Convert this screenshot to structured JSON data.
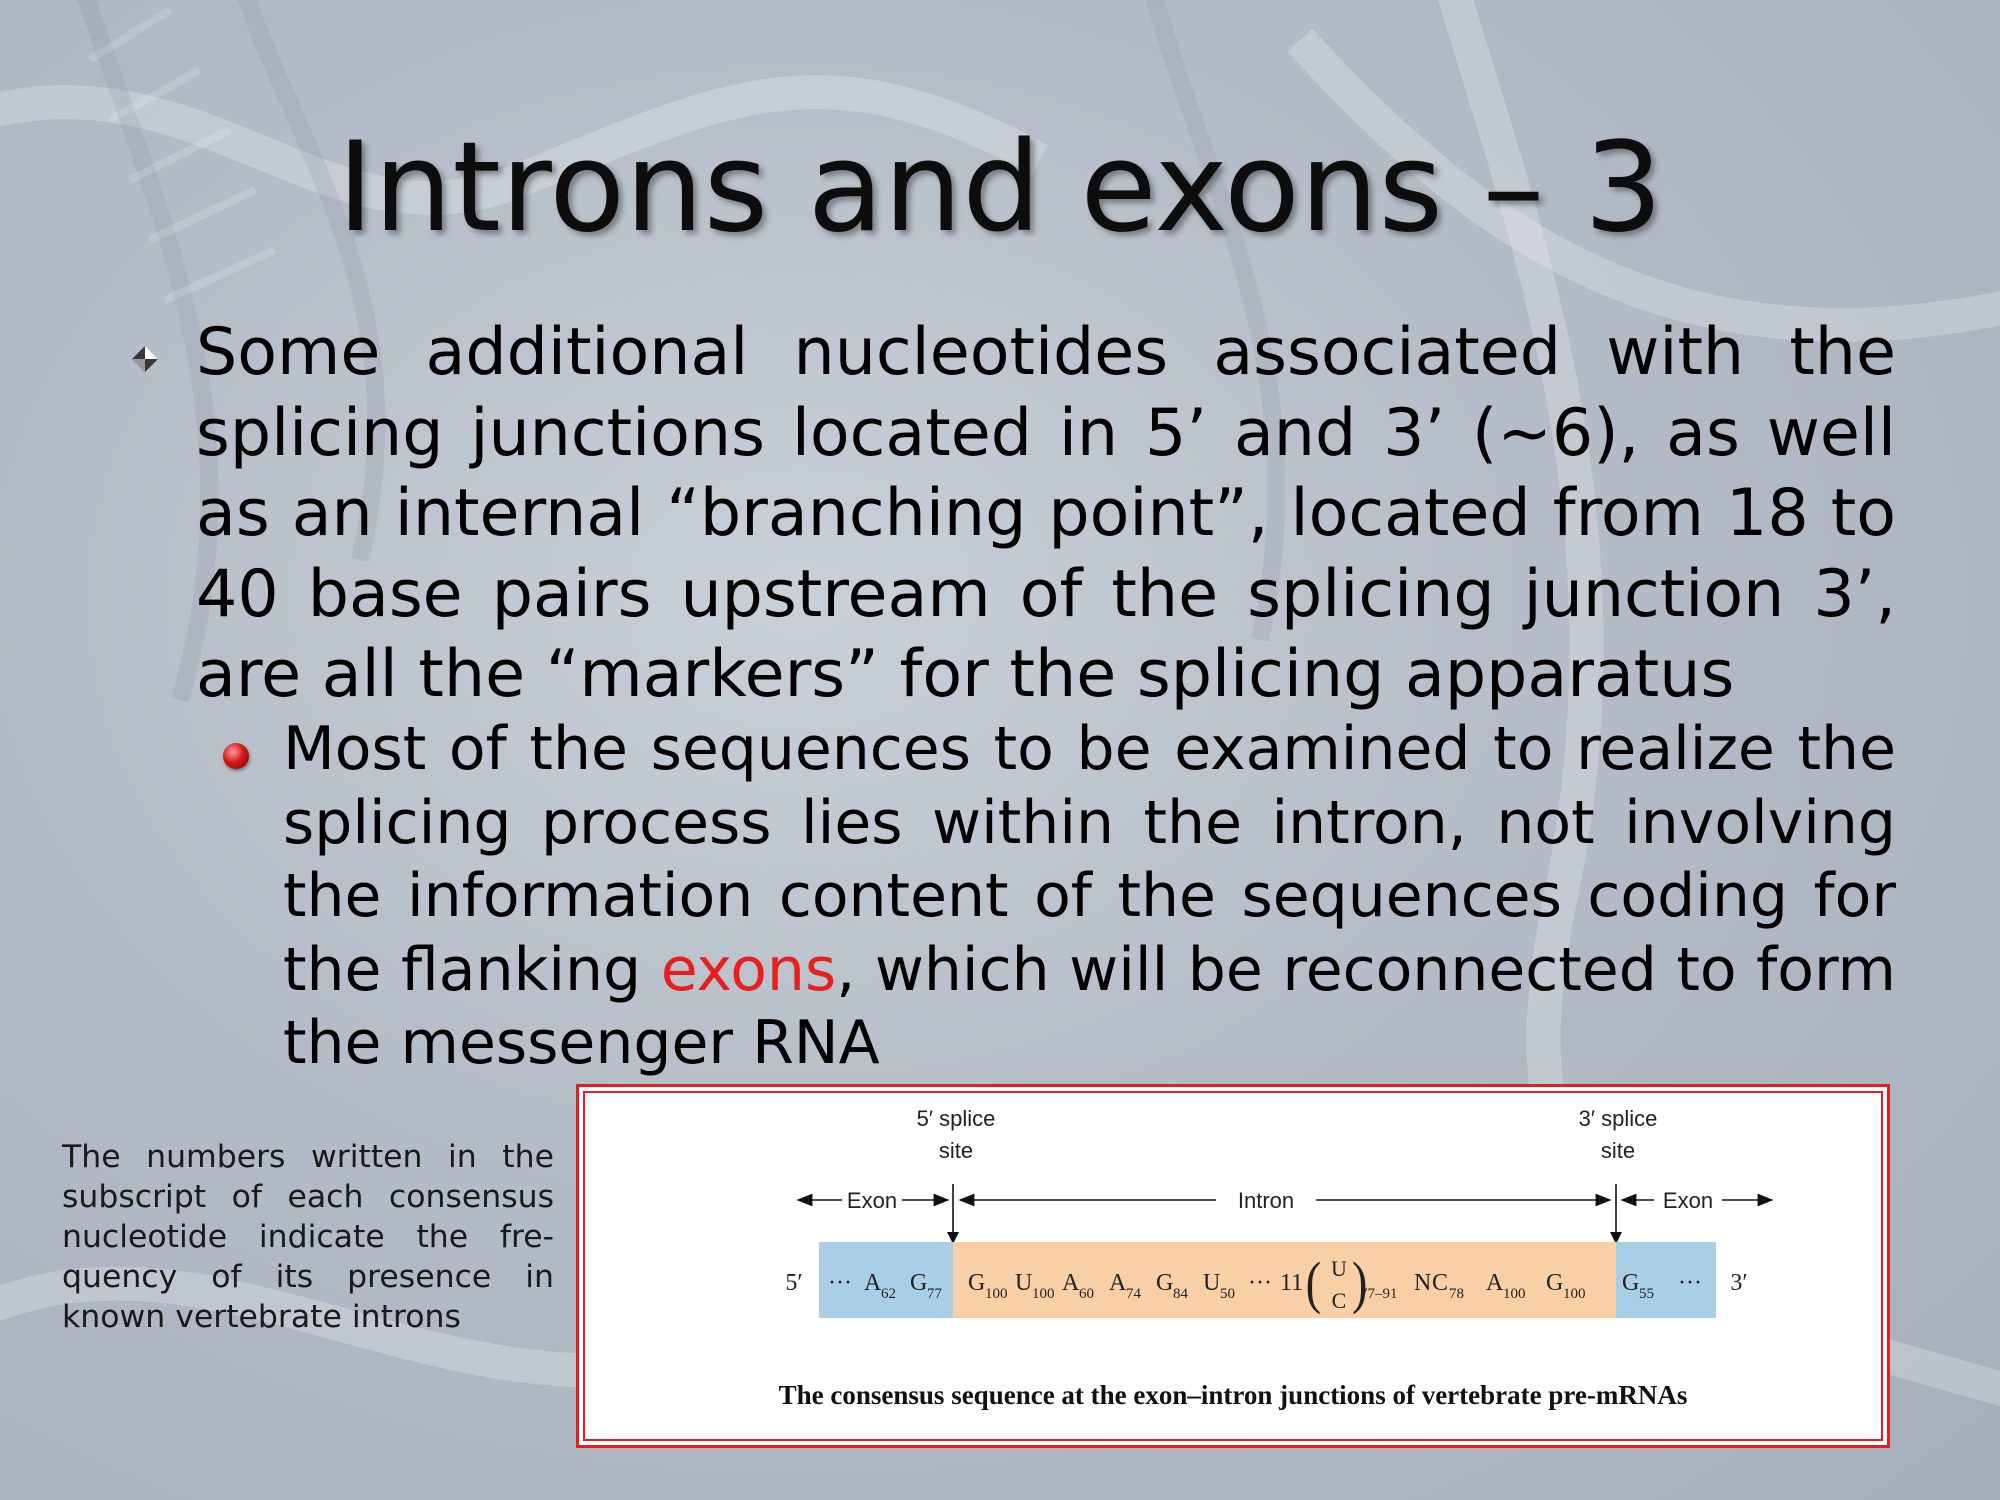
{
  "slide": {
    "title": "Introns and exons – 3",
    "bullet1": "Some additional nucleotides associated with the splicing junctions located in 5’ and 3’ (~6), as well as an internal “branching point”, located from 18 to 40 base pairs upstream of the splicing junction 3’, are all the “markers” for the splicing apparatus",
    "bullet2": {
      "before": "Most of the sequences to be examined to realize the splicing process lies within the intron, not involving the information content of the sequences coding for the flanking ",
      "highlight": "exons",
      "after": ", which will be reconnected to form the messenger RNA"
    },
    "caption": "The numbers written in the subscript of each consensus nucleotide indicate the fre-quency of its presence in known vertebrate introns"
  },
  "figure": {
    "label_5_splice": "5′ splice",
    "label_3_splice": "3′ splice",
    "label_site": "site",
    "label_exon": "Exon",
    "label_intron": "Intron",
    "end_5": "5′",
    "end_3": "3′",
    "dots": "···",
    "n11": "11",
    "sub_77_91": "77–91",
    "caption": "The consensus sequence at the exon–intron junctions of vertebrate pre-mRNAs",
    "exon5_nts": [
      {
        "base": "A",
        "freq": "62"
      },
      {
        "base": "G",
        "freq": "77"
      }
    ],
    "intron_5_nts": [
      {
        "base": "G",
        "freq": "100"
      },
      {
        "base": "U",
        "freq": "100"
      },
      {
        "base": "A",
        "freq": "60"
      },
      {
        "base": "A",
        "freq": "74"
      },
      {
        "base": "G",
        "freq": "84"
      },
      {
        "base": "U",
        "freq": "50"
      }
    ],
    "pyrimidine_top": "U",
    "pyrimidine_bottom": "C",
    "intron_3_nts": [
      {
        "base": "N",
        "freq": ""
      },
      {
        "base": "C",
        "freq": "78"
      },
      {
        "base": "A",
        "freq": "100"
      },
      {
        "base": "G",
        "freq": "100"
      }
    ],
    "exon3_nts": [
      {
        "base": "G",
        "freq": "55"
      }
    ]
  },
  "colors": {
    "exon_fill": "#a9cfe6",
    "intron_fill": "#f9d0a6",
    "highlight": "#e8201d",
    "frame": "#e02020",
    "bullet_red": "#d41a1a"
  }
}
